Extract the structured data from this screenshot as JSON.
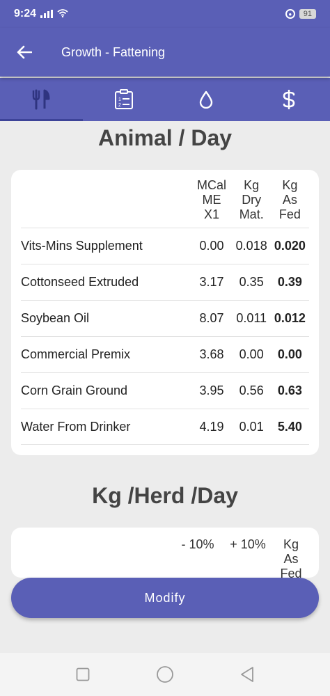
{
  "status_bar": {
    "time": "9:24",
    "battery": "91"
  },
  "app_bar": {
    "title": "Growth - Fattening"
  },
  "tabs": [
    {
      "name": "rations",
      "icon": "fork-knife-icon",
      "active": true
    },
    {
      "name": "report",
      "icon": "clipboard-list-icon",
      "active": false
    },
    {
      "name": "water",
      "icon": "water-drop-icon",
      "active": false
    },
    {
      "name": "cost",
      "icon": "dollar-icon",
      "active": false
    }
  ],
  "animal_day": {
    "title": "Animal / Day",
    "columns": [
      {
        "line1": "MCal",
        "line2": "ME",
        "line3": "X1"
      },
      {
        "line1": "Kg",
        "line2": "Dry",
        "line3": "Mat."
      },
      {
        "line1": "Kg",
        "line2": "As",
        "line3": "Fed"
      }
    ],
    "rows": [
      {
        "name": "Vits-Mins Supplement",
        "mcal": "0.00",
        "dry": "0.018",
        "fed": "0.020"
      },
      {
        "name": "Cottonseed Extruded",
        "mcal": "3.17",
        "dry": "0.35",
        "fed": "0.39"
      },
      {
        "name": "Soybean Oil",
        "mcal": "8.07",
        "dry": "0.011",
        "fed": "0.012"
      },
      {
        "name": "Commercial Premix",
        "mcal": "3.68",
        "dry": "0.00",
        "fed": "0.00"
      },
      {
        "name": "Corn Grain Ground",
        "mcal": "3.95",
        "dry": "0.56",
        "fed": "0.63"
      },
      {
        "name": "Water From Drinker",
        "mcal": "4.19",
        "dry": "0.01",
        "fed": "5.40"
      }
    ]
  },
  "herd_day": {
    "title": "Kg /Herd /Day",
    "columns": {
      "minus": "- 10%",
      "plus": "+ 10%",
      "fed_line1": "Kg",
      "fed_line2": "As",
      "fed_line3": "Fed"
    }
  },
  "modify_label": "Modify"
}
